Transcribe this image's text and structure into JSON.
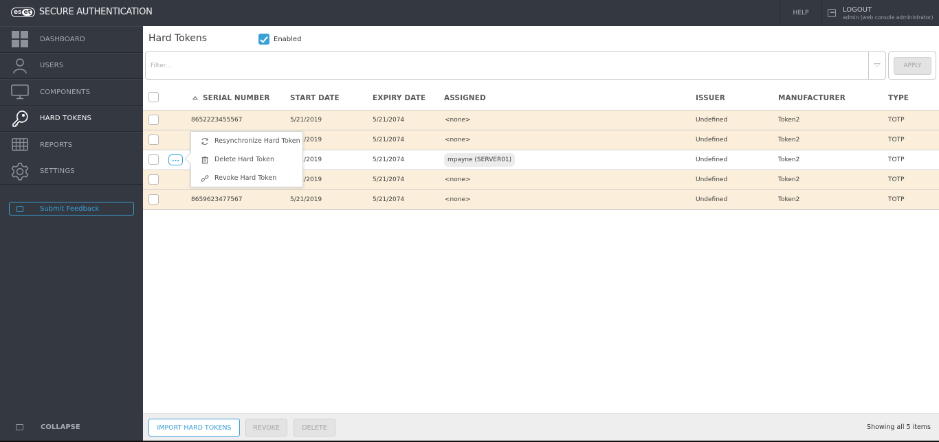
{
  "app": {
    "logo_text": "eset",
    "title": "SECURE AUTHENTICATION"
  },
  "topbar": {
    "help_label": "HELP",
    "logout_label": "LOGOUT",
    "user_label": "admin (web console administrator)"
  },
  "sidebar": {
    "items": [
      {
        "label": "DASHBOARD",
        "icon": "dashboard-icon",
        "active": false
      },
      {
        "label": "USERS",
        "icon": "user-icon",
        "active": false
      },
      {
        "label": "COMPONENTS",
        "icon": "monitor-icon",
        "active": false
      },
      {
        "label": "HARD TOKENS",
        "icon": "key-icon",
        "active": true
      },
      {
        "label": "REPORTS",
        "icon": "grid-icon",
        "active": false
      },
      {
        "label": "SETTINGS",
        "icon": "gear-icon",
        "active": false
      }
    ],
    "feedback_label": "Submit Feedback",
    "collapse_label": "COLLAPSE"
  },
  "main": {
    "title": "Hard Tokens",
    "enabled_label": "Enabled",
    "enabled_checked": true,
    "filter_placeholder": "Filter...",
    "filter_value": "",
    "apply_label": "APPLY"
  },
  "table": {
    "columns": [
      "SERIAL NUMBER",
      "START DATE",
      "EXPIRY DATE",
      "ASSIGNED",
      "ISSUER",
      "MANUFACTURER",
      "TYPE"
    ],
    "sorted_column": "SERIAL NUMBER",
    "sort_direction": "ascending",
    "rows": [
      {
        "serial": "8652223455567",
        "start": "5/21/2019",
        "expiry": "5/21/2074",
        "assigned": "<none>",
        "issuer": "Undefined",
        "manufacturer": "Token2",
        "type": "TOTP"
      },
      {
        "serial": "",
        "start": "5/21/2019",
        "expiry": "5/21/2074",
        "assigned": "<none>",
        "issuer": "Undefined",
        "manufacturer": "Token2",
        "type": "TOTP"
      },
      {
        "serial": "",
        "start": "5/21/2019",
        "expiry": "5/21/2074",
        "assigned": "mpayne (SERVER01)",
        "issuer": "Undefined",
        "manufacturer": "Token2",
        "type": "TOTP"
      },
      {
        "serial": "",
        "start": "5/21/2019",
        "expiry": "5/21/2074",
        "assigned": "<none>",
        "issuer": "Undefined",
        "manufacturer": "Token2",
        "type": "TOTP"
      },
      {
        "serial": "8659623477567",
        "start": "5/21/2019",
        "expiry": "5/21/2074",
        "assigned": "<none>",
        "issuer": "Undefined",
        "manufacturer": "Token2",
        "type": "TOTP"
      }
    ],
    "more_button_label": "...",
    "context_menu": [
      {
        "label": "Resynchronize Hard Token",
        "icon": "sync-icon"
      },
      {
        "label": "Delete Hard Token",
        "icon": "trash-icon"
      },
      {
        "label": "Revoke Hard Token",
        "icon": "unlink-icon"
      }
    ]
  },
  "footer": {
    "import_label": "IMPORT HARD TOKENS",
    "revoke_label": "REVOKE",
    "delete_label": "DELETE",
    "status": "Showing all 5 items"
  },
  "colors": {
    "accent": "#3aa0d6",
    "sidebar_bg": "#343841",
    "row_highlight": "#fbefdb"
  }
}
